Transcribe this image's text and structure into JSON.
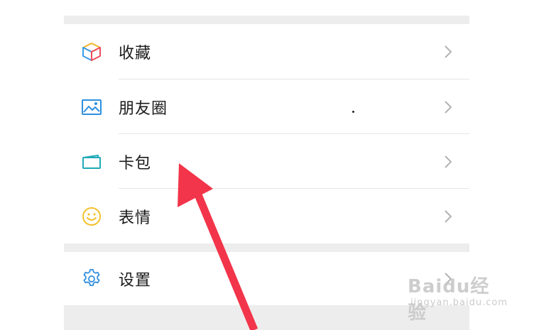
{
  "menu": {
    "items": [
      {
        "label": "收藏",
        "icon": "favorites-cube-icon"
      },
      {
        "label": "朋友圈",
        "icon": "moments-image-icon"
      },
      {
        "label": "卡包",
        "icon": "card-wallet-icon"
      },
      {
        "label": "表情",
        "icon": "sticker-smile-icon"
      }
    ],
    "settings": {
      "label": "设置",
      "icon": "gear-icon"
    }
  },
  "colors": {
    "background": "#ffffff",
    "section_gap": "#ededed",
    "divider": "#e6e6e6",
    "text": "#1a1a1a",
    "chevron": "#b2b2b2",
    "annotation_arrow": "#f2354a"
  },
  "watermark": {
    "main": "Baidu经验",
    "sub": "jingyan.baidu.com"
  }
}
